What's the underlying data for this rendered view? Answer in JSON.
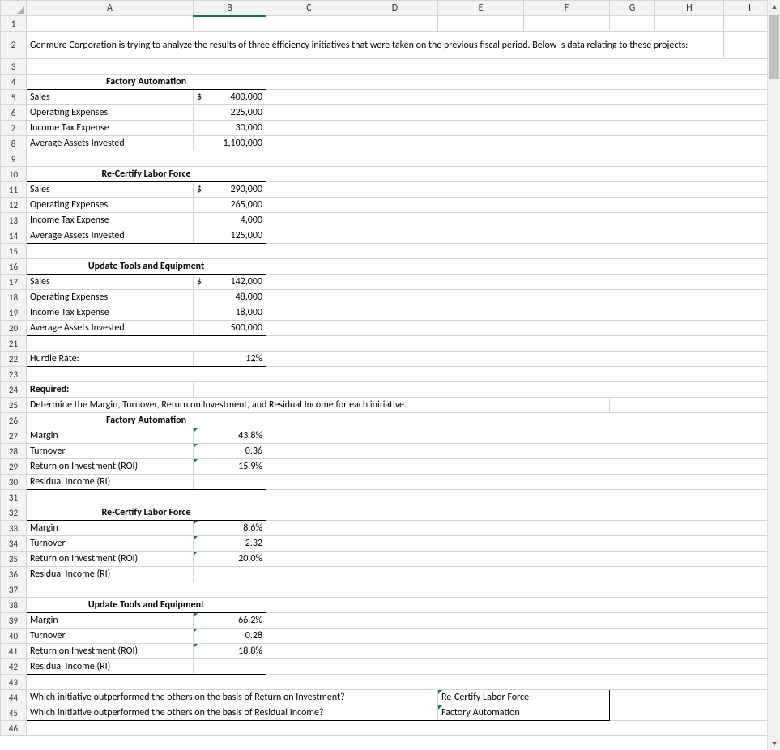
{
  "columns": [
    "A",
    "B",
    "C",
    "D",
    "E",
    "F",
    "G",
    "H",
    "I"
  ],
  "intro": "Genmure Corporation is trying to analyze the results of three efficiency initiatives that were taken on the previous fiscal period. Below is data relating to these projects:",
  "section1": {
    "title": "Factory Automation",
    "rows": [
      {
        "label": "Sales",
        "currency": "$",
        "value": "400,000"
      },
      {
        "label": "Operating Expenses",
        "currency": "",
        "value": "225,000"
      },
      {
        "label": "Income Tax Expense",
        "currency": "",
        "value": "30,000"
      },
      {
        "label": "Average Assets Invested",
        "currency": "",
        "value": "1,100,000"
      }
    ]
  },
  "section2": {
    "title": "Re-Certify Labor Force",
    "rows": [
      {
        "label": "Sales",
        "currency": "$",
        "value": "290,000"
      },
      {
        "label": "Operating Expenses",
        "currency": "",
        "value": "265,000"
      },
      {
        "label": "Income Tax Expense",
        "currency": "",
        "value": "4,000"
      },
      {
        "label": "Average Assets Invested",
        "currency": "",
        "value": "125,000"
      }
    ]
  },
  "section3": {
    "title": "Update Tools and Equipment",
    "rows": [
      {
        "label": "Sales",
        "currency": "$",
        "value": "142,000"
      },
      {
        "label": "Operating Expenses",
        "currency": "",
        "value": "48,000"
      },
      {
        "label": "Income Tax Expense",
        "currency": "",
        "value": "18,000"
      },
      {
        "label": "Average Assets Invested",
        "currency": "",
        "value": "500,000"
      }
    ]
  },
  "hurdle": {
    "label": "Hurdle Rate:",
    "value": "12%"
  },
  "required_label": "Required:",
  "required_text": "Determine the Margin, Turnover, Return on Investment, and Residual Income for each initiative.",
  "results": [
    {
      "title": "Factory Automation",
      "rows": [
        {
          "label": "Margin",
          "value": "43.8%"
        },
        {
          "label": "Turnover",
          "value": "0.36"
        },
        {
          "label": "Return on Investment (ROI)",
          "value": "15.9%"
        },
        {
          "label": "Residual Income (RI)",
          "value": ""
        }
      ]
    },
    {
      "title": "Re-Certify Labor Force",
      "rows": [
        {
          "label": "Margin",
          "value": "8.6%"
        },
        {
          "label": "Turnover",
          "value": "2.32"
        },
        {
          "label": "Return on Investment (ROI)",
          "value": "20.0%"
        },
        {
          "label": "Residual Income (RI)",
          "value": ""
        }
      ]
    },
    {
      "title": "Update Tools and Equipment",
      "rows": [
        {
          "label": "Margin",
          "value": "66.2%"
        },
        {
          "label": "Turnover",
          "value": "0.28"
        },
        {
          "label": "Return on Investment (ROI)",
          "value": "18.8%"
        },
        {
          "label": "Residual Income (RI)",
          "value": ""
        }
      ]
    }
  ],
  "questions": [
    {
      "q": "Which initiative outperformed the others on the basis of Return on Investment?",
      "a": "Re-Certify Labor Force"
    },
    {
      "q": "Which initiative outperformed the others on the basis of Residual Income?",
      "a": "Factory Automation"
    }
  ]
}
